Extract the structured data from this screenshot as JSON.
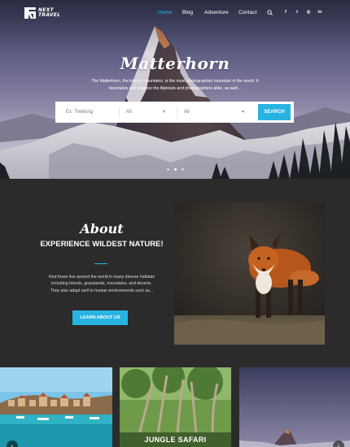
{
  "brand": {
    "line1": "NEXT",
    "line2": "TRAVEL",
    "logo_icon": "nt-logo-icon"
  },
  "nav": {
    "items": [
      {
        "label": "Home",
        "active": true
      },
      {
        "label": "Blog",
        "active": false
      },
      {
        "label": "Adventure",
        "active": false
      },
      {
        "label": "Contact",
        "active": false
      }
    ],
    "search_icon": "search-icon",
    "social": [
      {
        "icon": "facebook-icon",
        "glyph": "f"
      },
      {
        "icon": "twitter-icon",
        "glyph": "t"
      },
      {
        "icon": "instagram-icon",
        "glyph": "◎"
      },
      {
        "icon": "linkedin-icon",
        "glyph": "in"
      }
    ]
  },
  "hero": {
    "title": "Matterhorn",
    "description": "The Matterhorn, the king of mountains, is the most photographed mountain in the world. It fascinates and inspires the Alpinists and photographers alike, as well...",
    "search": {
      "keyword_placeholder": "Ex: Trekking",
      "select1_value": "All",
      "select2_value": "All",
      "button_label": "SEARCH"
    },
    "slides": 3,
    "active_slide": 1
  },
  "about": {
    "script_title": "About",
    "heading": "EXPERIENCE WILDEST NATURE!",
    "text": "Red foxes live around the world in many diverse habitats including forests, grasslands, mountains, and deserts. They also adapt well to human environments such as...",
    "button_label": "LEARN ABOUT US"
  },
  "cards": [
    {
      "title": ""
    },
    {
      "title": "JUNGLE SAFARI"
    },
    {
      "title": ""
    }
  ],
  "colors": {
    "accent": "#27b4e2",
    "dark_bg": "#2b2b2b"
  }
}
